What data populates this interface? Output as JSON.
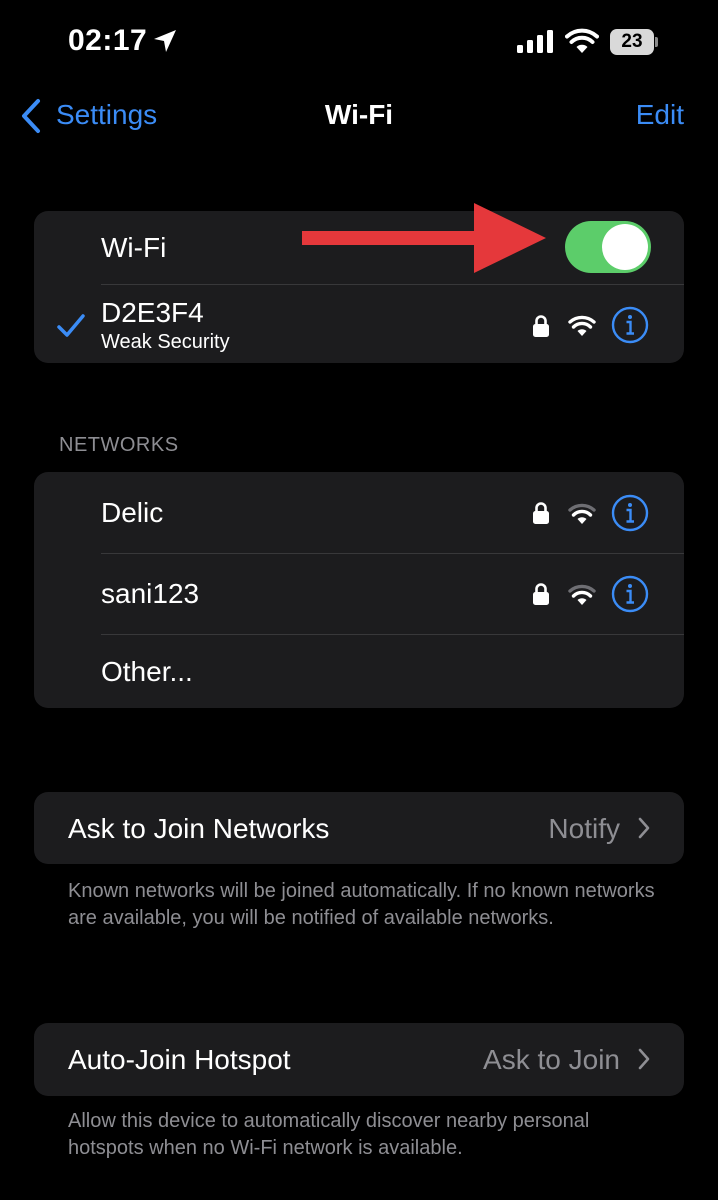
{
  "status_bar": {
    "time": "02:17",
    "battery": "23"
  },
  "nav": {
    "back_label": "Settings",
    "title": "Wi-Fi",
    "edit_label": "Edit"
  },
  "wifi_card": {
    "toggle_label": "Wi-Fi",
    "toggle_on": true,
    "connected_network": {
      "name": "D2E3F4",
      "subtitle": "Weak Security",
      "locked": true
    }
  },
  "networks": {
    "header": "NETWORKS",
    "items": [
      {
        "name": "Delic",
        "locked": true
      },
      {
        "name": "sani123",
        "locked": true
      }
    ],
    "other_label": "Other..."
  },
  "ask_to_join": {
    "label": "Ask to Join Networks",
    "value": "Notify",
    "footnote": "Known networks will be joined automatically. If no known networks are available, you will be notified of available networks."
  },
  "auto_join_hotspot": {
    "label": "Auto-Join Hotspot",
    "value": "Ask to Join",
    "footnote": "Allow this device to automatically discover nearby personal hotspots when no Wi-Fi network is available."
  },
  "colors": {
    "accent": "#3b8cf6",
    "toggle_on": "#5ccd6a",
    "card_bg": "#1c1c1e",
    "secondary_text": "#8e8e93",
    "annotation_arrow": "#e5383b"
  },
  "icons": [
    "location-arrow-icon",
    "cellular-signal-icon",
    "wifi-signal-icon",
    "battery-icon",
    "chevron-left-icon",
    "checkmark-icon",
    "lock-icon",
    "info-icon",
    "chevron-right-icon",
    "red-arrow-annotation"
  ]
}
